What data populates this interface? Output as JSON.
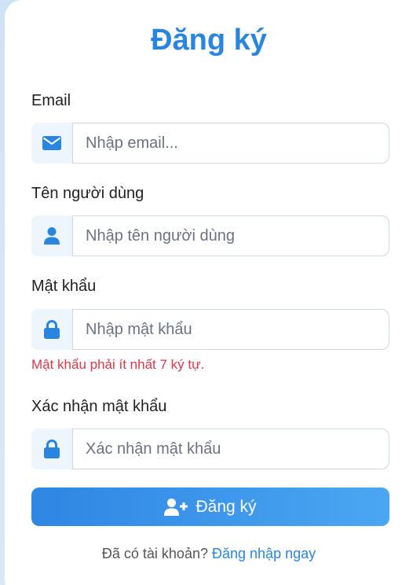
{
  "form": {
    "title": "Đăng ký",
    "fields": [
      {
        "label": "Email",
        "placeholder": "Nhập email...",
        "value": "",
        "icon": "envelope-icon"
      },
      {
        "label": "Tên người dùng",
        "placeholder": "Nhập tên người dùng",
        "value": "",
        "icon": "user-icon"
      },
      {
        "label": "Mật khẩu",
        "placeholder": "Nhập mật khẩu",
        "value": "",
        "icon": "lock-icon"
      },
      {
        "label": "Xác nhận mật khẩu",
        "placeholder": "Xác nhận mật khẩu",
        "value": "",
        "icon": "lock-icon"
      }
    ],
    "password_error": "Mật khẩu phải ít nhất 7 ký tự.",
    "submit_label": "Đăng ký",
    "submit_icon": "user-plus-icon",
    "footer_text": "Đã có tài khoản?",
    "login_link": "Đăng nhập ngay"
  },
  "colors": {
    "accent": "#2a85e0",
    "error": "#d9384a",
    "addon_bg": "#eef5fd"
  }
}
